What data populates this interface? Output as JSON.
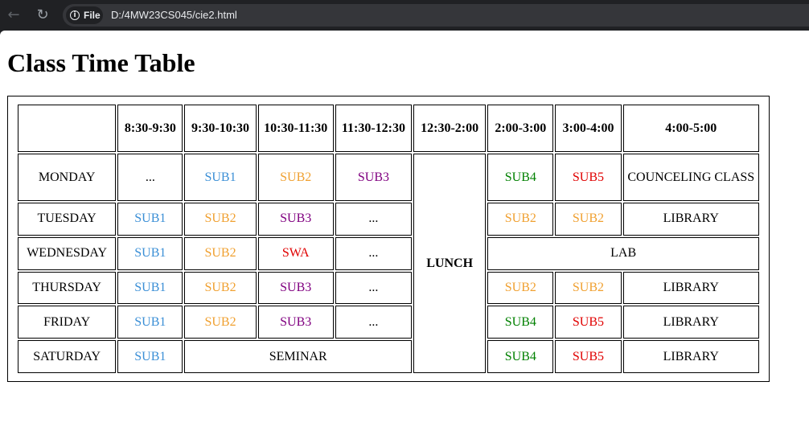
{
  "browser": {
    "site_label": "File",
    "url": "D:/4MW23CS045/cie2.html"
  },
  "page": {
    "title": "Class Time Table"
  },
  "colors": {
    "SUB1": "#3b8fd6",
    "SUB2": "#f0a030",
    "SUB3": "#800080",
    "SUB4": "#008000",
    "SUB5": "#e00000",
    "SWA": "#e00000",
    "default": "#000000"
  },
  "timetable": {
    "headers": [
      "",
      "8:30-9:30",
      "9:30-10:30",
      "10:30-11:30",
      "11:30-12:30",
      "12:30-2:00",
      "2:00-3:00",
      "3:00-4:00",
      "4:00-5:00"
    ],
    "lunch": "LUNCH",
    "rows": [
      {
        "day": "MONDAY",
        "cells": [
          {
            "text": "...",
            "span": 1
          },
          {
            "text": "SUB1",
            "span": 1
          },
          {
            "text": "SUB2",
            "span": 1
          },
          {
            "text": "SUB3",
            "span": 1
          },
          {
            "text": "SUB4",
            "span": 1
          },
          {
            "text": "SUB5",
            "span": 1
          },
          {
            "text": "COUNCELING CLASS",
            "span": 1
          }
        ]
      },
      {
        "day": "TUESDAY",
        "cells": [
          {
            "text": "SUB1",
            "span": 1
          },
          {
            "text": "SUB2",
            "span": 1
          },
          {
            "text": "SUB3",
            "span": 1
          },
          {
            "text": "...",
            "span": 1
          },
          {
            "text": "SUB2",
            "span": 1
          },
          {
            "text": "SUB2",
            "span": 1
          },
          {
            "text": "LIBRARY",
            "span": 1
          }
        ]
      },
      {
        "day": "WEDNESDAY",
        "cells": [
          {
            "text": "SUB1",
            "span": 1
          },
          {
            "text": "SUB2",
            "span": 1
          },
          {
            "text": "SWA",
            "span": 1
          },
          {
            "text": "...",
            "span": 1
          },
          {
            "text": "LAB",
            "span": 3
          }
        ]
      },
      {
        "day": "THURSDAY",
        "cells": [
          {
            "text": "SUB1",
            "span": 1
          },
          {
            "text": "SUB2",
            "span": 1
          },
          {
            "text": "SUB3",
            "span": 1
          },
          {
            "text": "...",
            "span": 1
          },
          {
            "text": "SUB2",
            "span": 1
          },
          {
            "text": "SUB2",
            "span": 1
          },
          {
            "text": "LIBRARY",
            "span": 1
          }
        ]
      },
      {
        "day": "FRIDAY",
        "cells": [
          {
            "text": "SUB1",
            "span": 1
          },
          {
            "text": "SUB2",
            "span": 1
          },
          {
            "text": "SUB3",
            "span": 1
          },
          {
            "text": "...",
            "span": 1
          },
          {
            "text": "SUB4",
            "span": 1
          },
          {
            "text": "SUB5",
            "span": 1
          },
          {
            "text": "LIBRARY",
            "span": 1
          }
        ]
      },
      {
        "day": "SATURDAY",
        "cells": [
          {
            "text": "SUB1",
            "span": 1
          },
          {
            "text": "SEMINAR",
            "span": 3
          },
          {
            "text": "SUB4",
            "span": 1
          },
          {
            "text": "SUB5",
            "span": 1
          },
          {
            "text": "LIBRARY",
            "span": 1
          }
        ]
      }
    ]
  }
}
